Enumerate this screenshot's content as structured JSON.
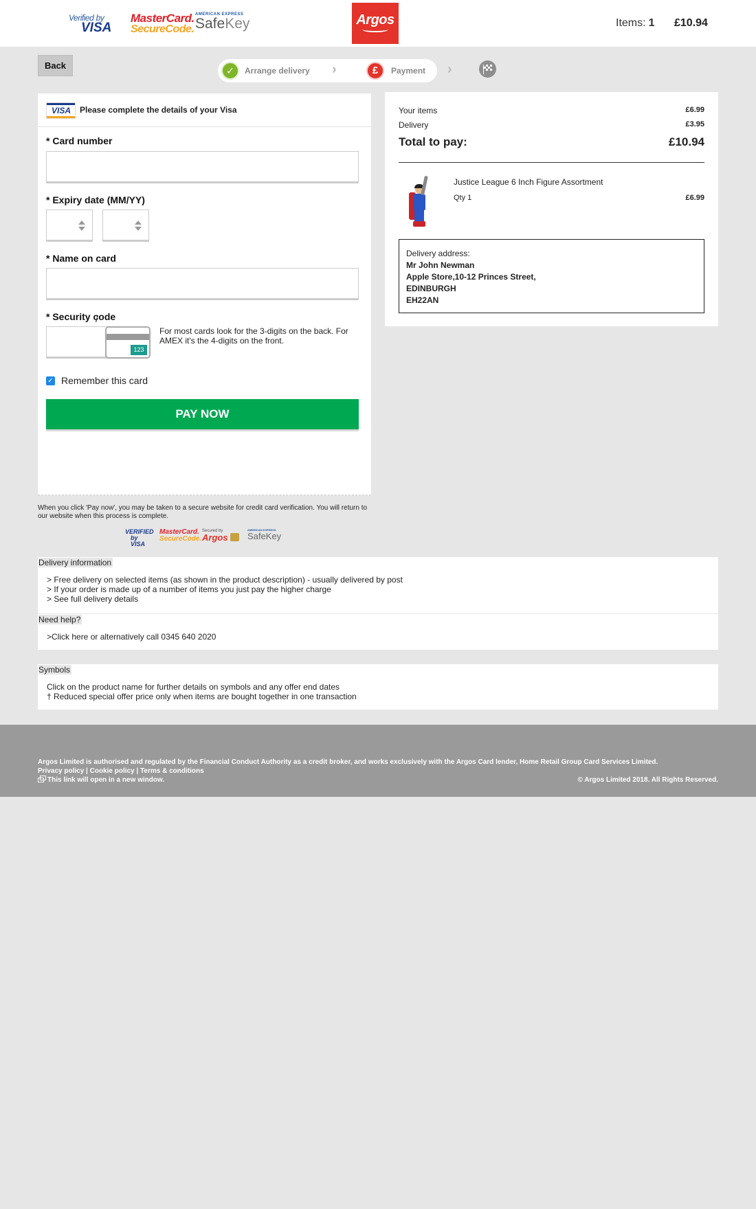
{
  "header": {
    "verified_by_visa": {
      "line1": "Verified",
      "line1_small": "by",
      "line2": "VISA"
    },
    "mastercard_securecode": {
      "line1": "MasterCard.",
      "line2": "SecureCode."
    },
    "amex_safekey": {
      "line1": "AMERICAN EXPRESS",
      "safe": "Safe",
      "key": "Key"
    },
    "logo_text": "Argos",
    "items_label": "Items:",
    "items_count": "1",
    "total": "£10.94"
  },
  "nav": {
    "back_label": "Back",
    "steps": [
      {
        "label": "Arrange delivery",
        "state": "done",
        "icon": "check-icon"
      },
      {
        "label": "Payment",
        "state": "current",
        "icon": "pound-icon",
        "symbol": "£"
      },
      {
        "label": "",
        "state": "upcoming",
        "icon": "finish-flag-icon"
      }
    ]
  },
  "card_form": {
    "title": "Please complete the details of your Visa",
    "card_brand": "VISA",
    "card_number_label": "* Card number",
    "card_number_value": "",
    "expiry_label": "* Expiry date (MM/YY)",
    "expiry_month": "",
    "expiry_year": "",
    "expiry_separator": "/",
    "name_label": "* Name on card",
    "name_value": "",
    "security_label": "* Security code",
    "security_value": "",
    "security_sample": "123",
    "security_help": "For most cards look for the 3-digits on the back. For AMEX it's the 4-digits on the front.",
    "remember_label": "Remember this card",
    "remember_checked": true,
    "pay_button": "PAY NOW"
  },
  "secure_note": "When you click 'Pay now', you may be taken to a secure website for credit card verification. You will return to our website when this process is complete.",
  "secure_logos": {
    "vbv_line1": "VERIFIED",
    "vbv_line2": "by VISA",
    "mc_line1": "MasterCard.",
    "mc_line2": "SecureCode.",
    "argos_secured": "Secured by",
    "argos_name": "Argos",
    "sk_amex": "AMERICAN EXPRESS",
    "sk_name": "SafeKey"
  },
  "summary": {
    "your_items_label": "Your items",
    "your_items_value": "£6.99",
    "delivery_label": "Delivery",
    "delivery_value": "£3.95",
    "total_label": "Total to pay:",
    "total_value": "£10.94",
    "product": {
      "name": "Justice League 6 Inch Figure Assortment",
      "qty": "Qty 1",
      "price": "£6.99"
    },
    "address": {
      "label": "Delivery address:",
      "lines": [
        "Mr John Newman",
        "Apple Store,10-12 Princes Street,",
        "EDINBURGH",
        "EH22AN"
      ]
    }
  },
  "delivery_info": {
    "heading": "Delivery information",
    "lines": [
      "> Free delivery on selected items (as shown in the product description) - usually delivered by post",
      "> If your order is made up of a number of items you just pay the higher charge",
      "> See full delivery details"
    ]
  },
  "help": {
    "heading": "Need help?",
    "line": ">Click here or alternatively call 0345 640 2020"
  },
  "symbols": {
    "heading": "Symbols",
    "lines": [
      "Click on the product name for further details on symbols and any offer end dates",
      "† Reduced special offer price only when items are bought together in one transaction"
    ]
  },
  "footer": {
    "regulation": "Argos Limited is authorised and regulated by the Financial Conduct Authority as a credit broker, and works exclusively with the Argos Card lender, Home Retail Group Card Services Limited.",
    "links": [
      "Privacy policy",
      "Cookie policy",
      "Terms & conditions"
    ],
    "link_separator": "|",
    "new_window": "This link will open in a new window.",
    "copyright": "© Argos Limited 2018. All Rights Reserved."
  },
  "colors": {
    "brand_red": "#e3332a",
    "pay_green": "#00a852",
    "step_done_green": "#7fb528",
    "page_bg": "#e6e6e6",
    "footer_bg": "#9a9a9a"
  }
}
